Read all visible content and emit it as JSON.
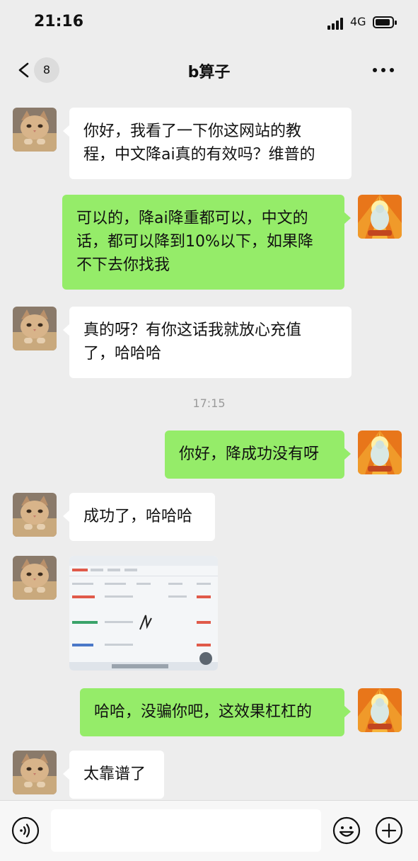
{
  "status_bar": {
    "time": "21:16",
    "network": "4G"
  },
  "nav": {
    "unread_count": "8",
    "title": "b算子"
  },
  "messages": [
    {
      "side": "left",
      "text_lines": [
        "你好，我看了一下你这网站的教",
        "程，中文降ai真的有效吗？维普的"
      ]
    },
    {
      "side": "right",
      "text_lines": [
        "可以的，降ai降重都可以，中文的",
        "话，都可以降到10%以下，如果降",
        "不下去你找我"
      ]
    },
    {
      "side": "left",
      "text_lines": [
        "真的呀？有你这话我就放心充值",
        "了，哈哈哈"
      ]
    },
    {
      "side": "right",
      "text_lines": [
        "你好，降成功没有呀"
      ]
    },
    {
      "side": "left",
      "text_lines": [
        "成功了，哈哈哈"
      ]
    },
    {
      "side": "right",
      "text_lines": [
        "哈哈，没骗你吧，这效果杠杠的"
      ]
    },
    {
      "side": "left",
      "text_lines": [
        "太靠谱了"
      ]
    }
  ],
  "time_divider": "17:15",
  "image_message": {
    "icon": "photo-thumbnail"
  },
  "input_bar": {
    "icons": [
      "voice-icon",
      "emoji-icon",
      "add-icon"
    ]
  }
}
